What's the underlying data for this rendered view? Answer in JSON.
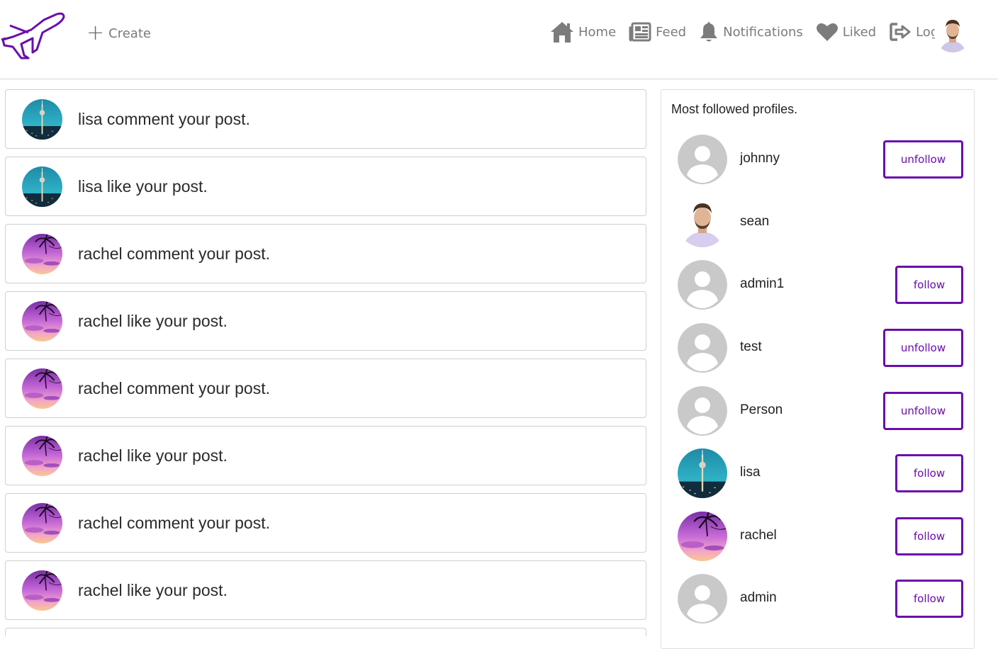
{
  "brand": {
    "logo_icon": "airplane-icon",
    "accent": "#6a0dad"
  },
  "header": {
    "create_label": "Create",
    "nav": [
      {
        "label": "Home",
        "icon": "home-icon"
      },
      {
        "label": "Feed",
        "icon": "newspaper-icon"
      },
      {
        "label": "Notifications",
        "icon": "bell-icon"
      },
      {
        "label": "Liked",
        "icon": "heart-icon"
      },
      {
        "label": "Logout",
        "icon": "logout-icon"
      }
    ]
  },
  "notifications": [
    {
      "text": "lisa comment your post.",
      "avatar": "city-tower"
    },
    {
      "text": "lisa like your post.",
      "avatar": "city-tower"
    },
    {
      "text": "rachel comment your post.",
      "avatar": "palm-sunset"
    },
    {
      "text": "rachel like your post.",
      "avatar": "palm-sunset"
    },
    {
      "text": "rachel comment your post.",
      "avatar": "palm-sunset"
    },
    {
      "text": "rachel like your post.",
      "avatar": "palm-sunset"
    },
    {
      "text": "rachel comment your post.",
      "avatar": "palm-sunset"
    },
    {
      "text": "rachel like your post.",
      "avatar": "palm-sunset"
    }
  ],
  "sidebar": {
    "title": "Most followed profiles.",
    "profiles": [
      {
        "name": "johnny",
        "avatar": "default",
        "button": "unfollow"
      },
      {
        "name": "sean",
        "avatar": "photo-man",
        "button": ""
      },
      {
        "name": "admin1",
        "avatar": "default",
        "button": "follow"
      },
      {
        "name": "test",
        "avatar": "default",
        "button": "unfollow"
      },
      {
        "name": "Person",
        "avatar": "default",
        "button": "unfollow"
      },
      {
        "name": "lisa",
        "avatar": "city-tower",
        "button": "follow"
      },
      {
        "name": "rachel",
        "avatar": "palm-sunset",
        "button": "follow"
      },
      {
        "name": "admin",
        "avatar": "default",
        "button": "follow"
      }
    ]
  }
}
